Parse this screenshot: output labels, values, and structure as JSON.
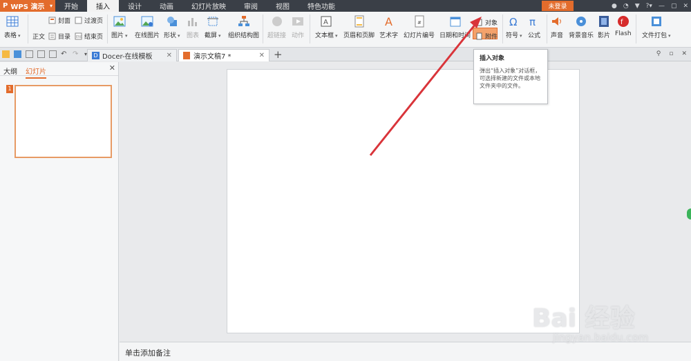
{
  "menu": {
    "app_name": "WPS 演示",
    "items": [
      "开始",
      "插入",
      "设计",
      "动画",
      "幻灯片放映",
      "审阅",
      "视图",
      "特色功能"
    ],
    "active": "插入",
    "login": "未登录"
  },
  "ribbon": {
    "table": "表格",
    "cover": "封面",
    "transition_page": "过渡页",
    "body": "正文",
    "toc": "目录",
    "end_page": "结束页",
    "picture": "图片",
    "online_picture": "在线图片",
    "shape": "形状",
    "chart": "图表",
    "screenshot": "截屏",
    "org_chart": "组织结构图",
    "hyperlink": "超链接",
    "action": "动作",
    "textbox": "文本框",
    "header_footer": "页眉和页脚",
    "wordart": "艺术字",
    "slide_number": "幻灯片编号",
    "datetime": "日期和时间",
    "object": "对象",
    "attachment": "附件",
    "symbol": "符号",
    "formula": "公式",
    "sound": "声音",
    "bg_music": "背景音乐",
    "movie": "影片",
    "flash": "Flash",
    "package": "文件打包"
  },
  "tabs": [
    {
      "label": "Docer-在线模板"
    },
    {
      "label": "演示文稿7 *"
    }
  ],
  "left_panel": {
    "tab_outline": "大纲",
    "tab_slides": "幻灯片",
    "slide_number": "1"
  },
  "notes_placeholder": "单击添加备注",
  "tooltip": {
    "title": "插入对象",
    "desc": "弹出“插入对象”对话框，可选择新建的文件或本地文件夹中的文件。"
  },
  "watermark": {
    "main": "Bai 经验",
    "sub": "jingyan.baidu.com"
  },
  "colors": {
    "accent": "#e36c2c",
    "menubar": "#3a3f47"
  }
}
